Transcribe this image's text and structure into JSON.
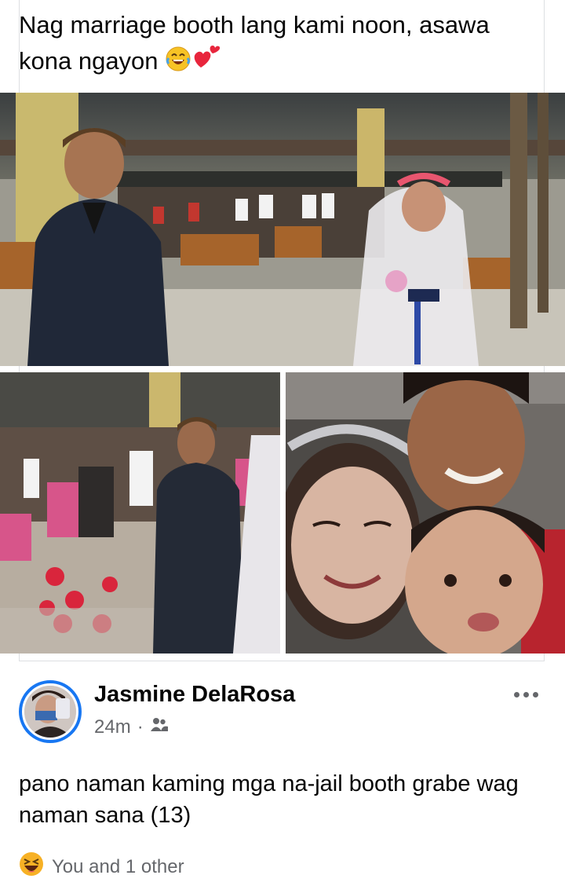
{
  "shared_post": {
    "caption": "Nag marriage booth lang kami noon, asawa kona ngayon",
    "caption_emojis": [
      "laughing-tears-emoji",
      "heart-emoji"
    ],
    "photos": [
      {
        "name": "wedding-booth-main-photo",
        "description": "groom in suit and bride in veil at school booth"
      },
      {
        "name": "wedding-booth-side-photo",
        "description": "groom standing among students"
      },
      {
        "name": "family-selfie-photo",
        "description": "couple with child selfie"
      }
    ]
  },
  "post": {
    "author": "Jasmine DelaRosa",
    "time": "24m",
    "separator": "·",
    "audience_icon": "friends-icon",
    "text": "pano naman kaming mga na-jail booth grabe wag naman sana (13)",
    "reactions_text": "You and 1 other",
    "reaction_icon": "haha-reaction-icon"
  },
  "colors": {
    "accent": "#1877f2",
    "secondary_text": "#65676b",
    "haha": "#f7b125"
  }
}
